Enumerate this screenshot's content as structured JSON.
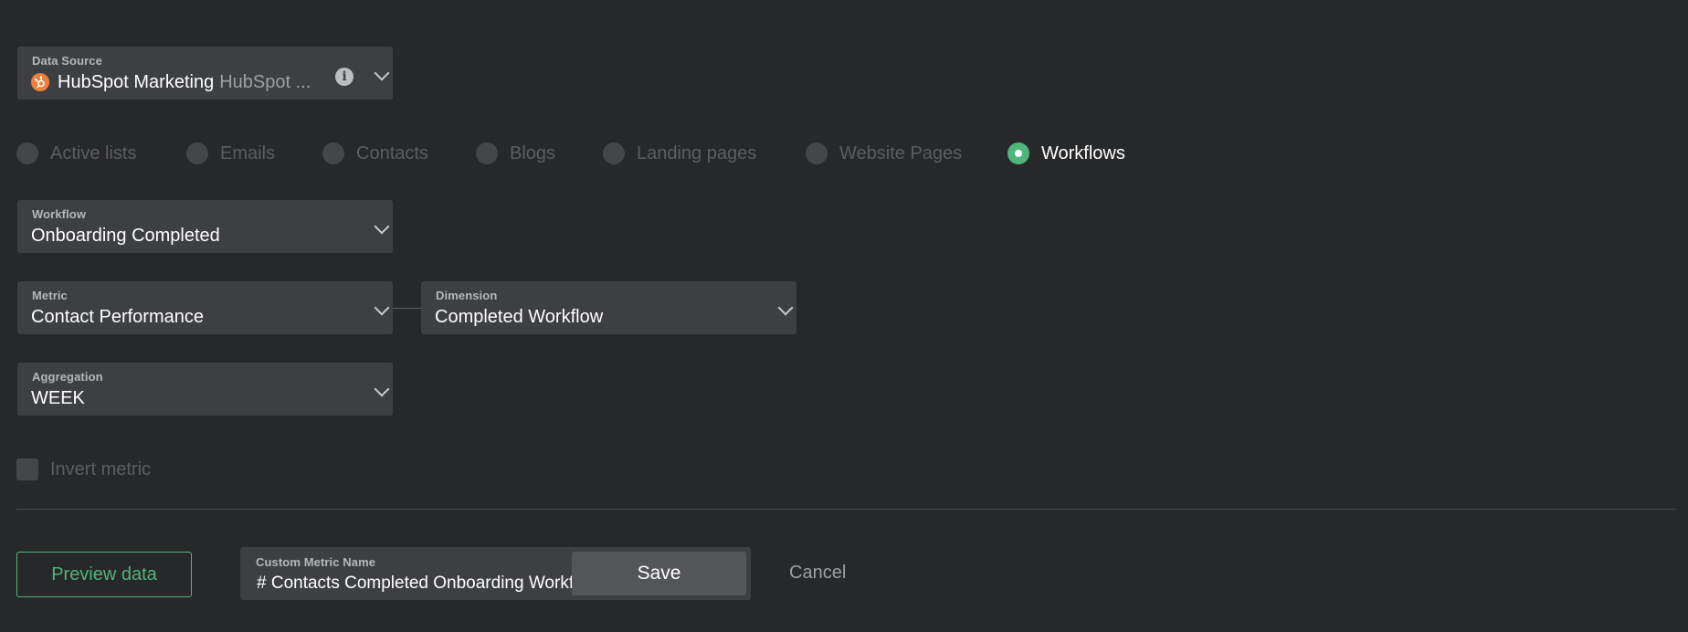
{
  "data_source": {
    "label": "Data Source",
    "value": "HubSpot Marketing",
    "secondary": "HubSpot ...",
    "logo_icon": "hubspot-logo",
    "brand_color": "#ef7f3b"
  },
  "object_types": [
    {
      "label": "Active lists",
      "selected": false
    },
    {
      "label": "Emails",
      "selected": false
    },
    {
      "label": "Contacts",
      "selected": false
    },
    {
      "label": "Blogs",
      "selected": false
    },
    {
      "label": "Landing pages",
      "selected": false
    },
    {
      "label": "Website Pages",
      "selected": false
    },
    {
      "label": "Workflows",
      "selected": true
    }
  ],
  "workflow": {
    "label": "Workflow",
    "value": "Onboarding Completed"
  },
  "metric": {
    "label": "Metric",
    "value": "Contact Performance"
  },
  "dimension": {
    "label": "Dimension",
    "value": "Completed Workflow"
  },
  "aggregation": {
    "label": "Aggregation",
    "value": "WEEK"
  },
  "invert_metric": {
    "label": "Invert metric",
    "checked": false
  },
  "footer": {
    "preview_label": "Preview data",
    "custom_metric_name": {
      "label": "Custom Metric Name",
      "value": "# Contacts Completed Onboarding Workflow"
    },
    "save_label": "Save",
    "cancel_label": "Cancel"
  },
  "colors": {
    "background": "#27282a",
    "field": "#3e3f42",
    "accent_green": "#4fb57c",
    "muted_text": "#5c5d61"
  }
}
